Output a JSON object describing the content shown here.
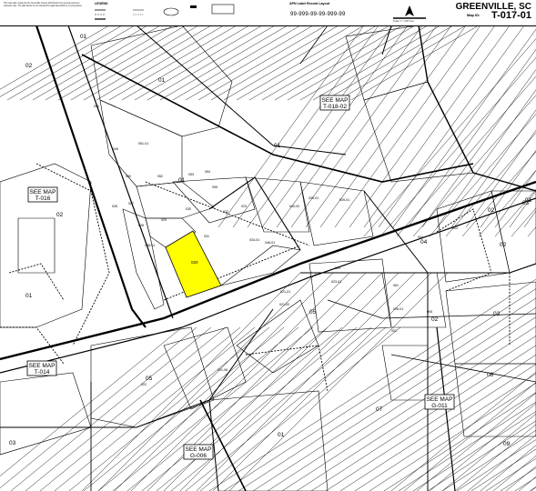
{
  "header": {
    "county": "GREENVILLE, SC",
    "map_id_label": "Map ID:",
    "map_id": "T-017-01",
    "legend_title": "LEGEND",
    "apn_title": "APN Label Record Layout",
    "apn_format": "99-999-99-99-999-99",
    "disclaimer": "This map was created by the Greenville County GIS Division for general reference purposes only. The data shown is not intended for legal descriptions or conveyances.",
    "scale_note": "Scale 1\" = 200 Feet"
  },
  "see_map_labels": [
    {
      "title": "SEE MAP",
      "id": "T-018-02"
    },
    {
      "title": "SEE MAP",
      "id": "T-016"
    },
    {
      "title": "SEE MAP",
      "id": "T-014"
    },
    {
      "title": "SEE MAP",
      "id": "G-006"
    },
    {
      "title": "SEE MAP",
      "id": "G-011"
    }
  ],
  "block_labels": [
    "01",
    "02",
    "01",
    "01",
    "01",
    "02",
    "03",
    "01",
    "02",
    "05",
    "05",
    "01",
    "07",
    "04",
    "02",
    "03",
    "08",
    "09",
    "03",
    "02",
    "01"
  ],
  "parcel_labels": [
    "051",
    "050",
    "049",
    "051-01",
    "052",
    "053",
    "054",
    "055",
    "026",
    "027",
    "028",
    "029",
    "030",
    "031",
    "032",
    "046-01",
    "048-01",
    "021-01",
    "021-02",
    "021-06",
    "022",
    "023",
    "023-01",
    "024",
    "034-01",
    "035-01",
    "039-01",
    "040-02",
    "061",
    "026-01",
    "004",
    "003",
    "005",
    "002"
  ],
  "highlight": {
    "parcel": "020",
    "color": "#ffff00"
  }
}
